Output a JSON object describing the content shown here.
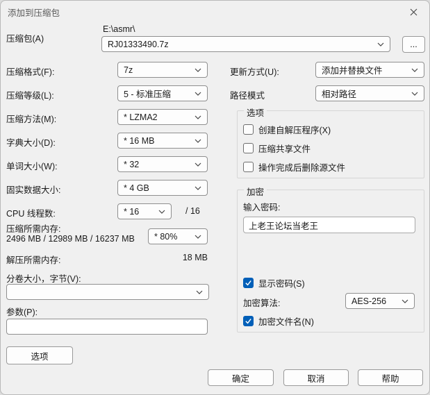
{
  "window": {
    "title": "添加到压缩包"
  },
  "archive": {
    "label": "压缩包(A)",
    "directory": "E:\\asmr\\",
    "filename": "RJ01333490.7z",
    "browse_label": "..."
  },
  "left": {
    "rows": [
      {
        "label": "压缩格式(F):",
        "value": "7z"
      },
      {
        "label": "压缩等级(L):",
        "value": "5 - 标准压缩"
      },
      {
        "label": "压缩方法(M):",
        "value": "* LZMA2"
      },
      {
        "label": "字典大小(D):",
        "value": "* 16 MB"
      },
      {
        "label": "单词大小(W):",
        "value": "* 32"
      },
      {
        "label": "固实数据大小:",
        "value": "* 4 GB"
      }
    ],
    "cpu_threads": {
      "label": "CPU 线程数:",
      "value": "* 16",
      "total": "/ 16"
    },
    "memory_compress": {
      "label": "压缩所需内存:",
      "detail": "2496 MB / 12989 MB / 16237 MB",
      "value": "* 80%"
    },
    "memory_decompress": {
      "label": "解压所需内存:",
      "value": "18 MB"
    },
    "volume_size": {
      "label": "分卷大小，字节(V):",
      "value": ""
    },
    "parameters": {
      "label": "参数(P):",
      "value": ""
    },
    "options_button": "选项"
  },
  "right": {
    "update_mode": {
      "label": "更新方式(U):",
      "value": "添加并替换文件"
    },
    "path_mode": {
      "label": "路径模式",
      "value": "相对路径"
    },
    "options_group": {
      "title": "选项",
      "items": [
        {
          "label": "创建自解压程序(X)",
          "checked": false
        },
        {
          "label": "压缩共享文件",
          "checked": false
        },
        {
          "label": "操作完成后删除源文件",
          "checked": false
        }
      ]
    },
    "encryption": {
      "title": "加密",
      "password_label": "输入密码:",
      "password_value": "上老王论坛当老王",
      "show_password": {
        "label": "显示密码(S)",
        "checked": true
      },
      "method": {
        "label": "加密算法:",
        "value": "AES-256"
      },
      "encrypt_names": {
        "label": "加密文件名(N)",
        "checked": true
      }
    }
  },
  "footer": {
    "ok": "确定",
    "cancel": "取消",
    "help": "帮助"
  },
  "colors": {
    "accent": "#005fb8",
    "dialog_bg": "#f0f0f0"
  }
}
